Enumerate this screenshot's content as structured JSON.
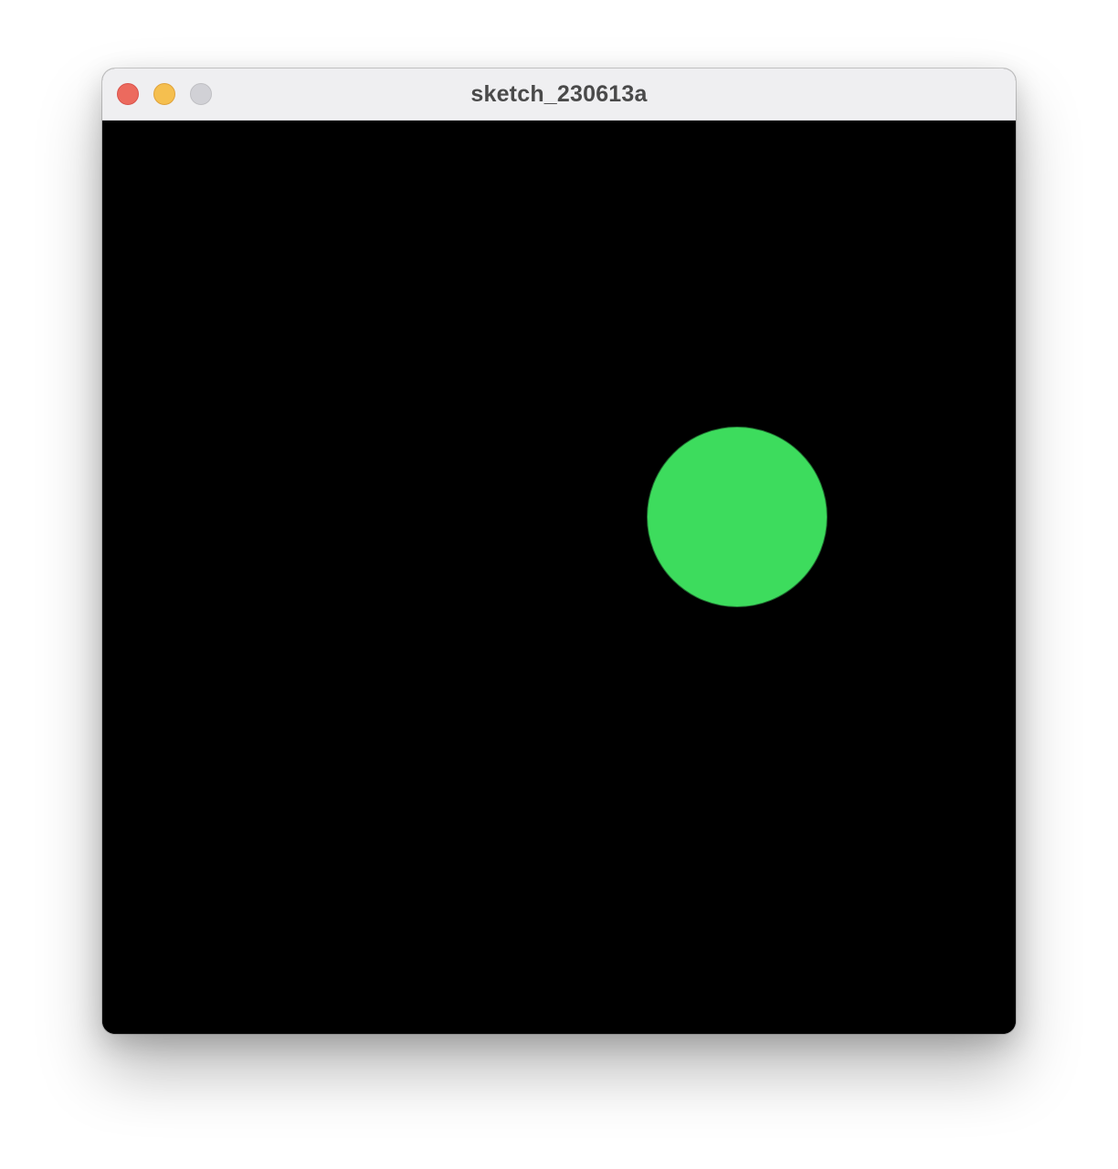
{
  "window": {
    "title": "sketch_230613a"
  },
  "colors": {
    "close": "#ec6a5e",
    "minimize": "#f5bf4f",
    "zoom_inactive": "#d1d1d6",
    "canvas_background": "#000000",
    "circle_fill": "#3ddc5d"
  },
  "icons": {
    "close": "close-icon",
    "minimize": "minimize-icon",
    "zoom": "zoom-icon"
  }
}
